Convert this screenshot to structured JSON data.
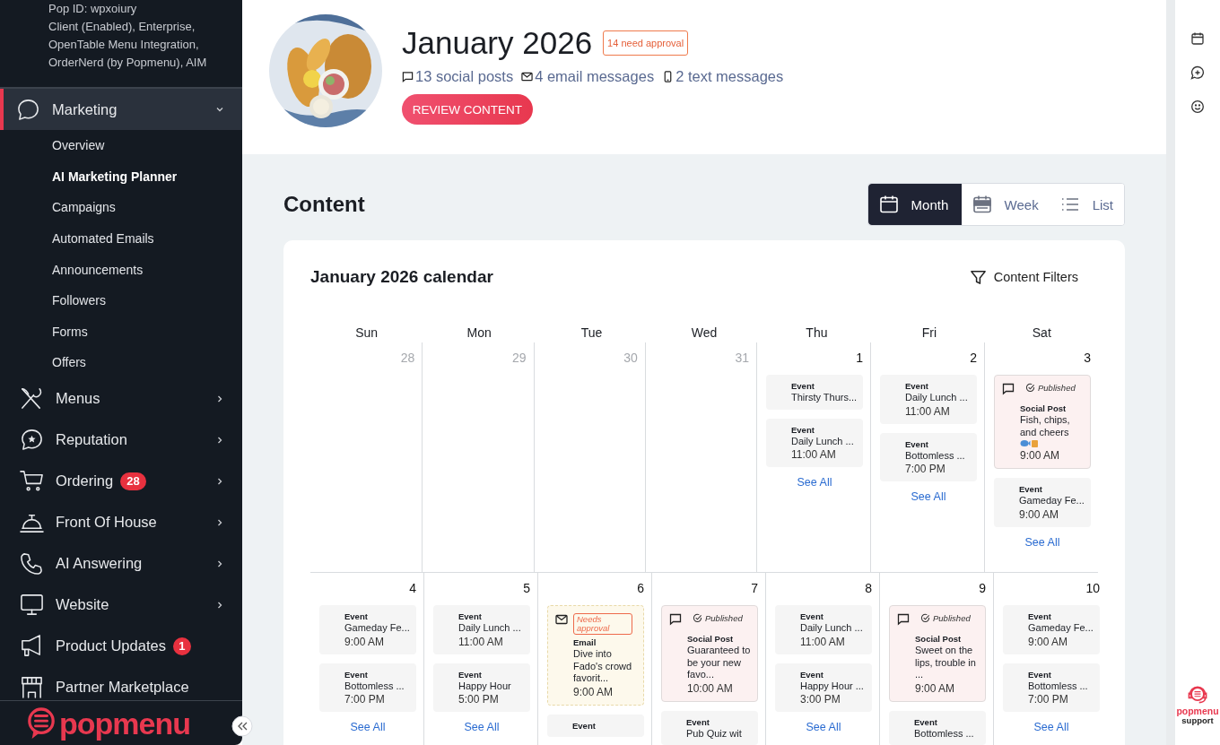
{
  "sidebar": {
    "account_lines": [
      "Pop ID: wpxoiury",
      "Client (Enabled), Enterprise,",
      "OpenTable Menu Integration,",
      "OrderNerd (by Popmenu), AIM"
    ],
    "nav": [
      {
        "label": "Marketing",
        "selected": true,
        "expanded": true,
        "children": [
          {
            "label": "Overview",
            "selected": false
          },
          {
            "label": "AI Marketing Planner",
            "selected": true
          },
          {
            "label": "Campaigns",
            "selected": false
          },
          {
            "label": "Automated Emails",
            "selected": false
          },
          {
            "label": "Announcements",
            "selected": false
          },
          {
            "label": "Followers",
            "selected": false
          },
          {
            "label": "Forms",
            "selected": false
          },
          {
            "label": "Offers",
            "selected": false
          }
        ]
      },
      {
        "label": "Menus",
        "selected": false,
        "expanded": false
      },
      {
        "label": "Reputation",
        "selected": false,
        "expanded": false
      },
      {
        "label": "Ordering",
        "selected": false,
        "expanded": false,
        "badge": "28"
      },
      {
        "label": "Front Of House",
        "selected": false,
        "expanded": false
      },
      {
        "label": "AI Answering",
        "selected": false,
        "expanded": false
      },
      {
        "label": "Website",
        "selected": false,
        "expanded": false
      },
      {
        "label": "Product Updates",
        "selected": false,
        "badge": "1"
      },
      {
        "label": "Partner Marketplace",
        "selected": false
      }
    ],
    "logo": "popmenu"
  },
  "header": {
    "title": "January 2026",
    "approval_badge": "14 need approval",
    "stats": [
      "13 social posts",
      "4 email messages",
      "2 text messages"
    ],
    "review_button": "REVIEW CONTENT"
  },
  "content": {
    "heading": "Content",
    "views": [
      {
        "label": "Month",
        "selected": true
      },
      {
        "label": "Week",
        "selected": false
      },
      {
        "label": "List",
        "selected": false
      }
    ]
  },
  "calendar": {
    "title": "January 2026 calendar",
    "filters_button": "Content Filters",
    "weekdays": [
      "Sun",
      "Mon",
      "Tue",
      "Wed",
      "Thu",
      "Fri",
      "Sat"
    ],
    "weeks": [
      {
        "days": [
          {
            "date": "28",
            "muted": true
          },
          {
            "date": "29",
            "muted": true
          },
          {
            "date": "30",
            "muted": true
          },
          {
            "date": "31",
            "muted": true
          },
          {
            "date": "1",
            "muted": false,
            "items": [
              {
                "kind": "event",
                "label": "Event",
                "title": "Thirsty Thurs..."
              },
              {
                "kind": "event",
                "label": "Event",
                "title": "Daily Lunch ...",
                "time": "11:00 AM"
              }
            ],
            "see_all": "See All"
          },
          {
            "date": "2",
            "muted": false,
            "items": [
              {
                "kind": "event",
                "label": "Event",
                "title": "Daily Lunch ...",
                "time": "11:00 AM"
              },
              {
                "kind": "event",
                "label": "Event",
                "title": "Bottomless ...",
                "time": "7:00 PM"
              }
            ],
            "see_all": "See All"
          },
          {
            "date": "3",
            "muted": false,
            "items": [
              {
                "kind": "social",
                "status": "Published",
                "label": "Social Post",
                "title": "Fish, chips, and cheers",
                "emoji": true,
                "time": "9:00 AM"
              },
              {
                "kind": "event",
                "label": "Event",
                "title": "Gameday Fe...",
                "time": "9:00 AM"
              }
            ],
            "see_all": "See All"
          }
        ]
      },
      {
        "days": [
          {
            "date": "4",
            "muted": false,
            "items": [
              {
                "kind": "event",
                "label": "Event",
                "title": "Gameday Fe...",
                "time": "9:00 AM"
              },
              {
                "kind": "event",
                "label": "Event",
                "title": "Bottomless ...",
                "time": "7:00 PM"
              }
            ],
            "see_all": "See All"
          },
          {
            "date": "5",
            "muted": false,
            "items": [
              {
                "kind": "event",
                "label": "Event",
                "title": "Daily Lunch ...",
                "time": "11:00 AM"
              },
              {
                "kind": "event",
                "label": "Event",
                "title": "Happy Hour",
                "time": "5:00 PM"
              }
            ],
            "see_all": "See All"
          },
          {
            "date": "6",
            "muted": false,
            "items": [
              {
                "kind": "email",
                "status": "Needs approval",
                "label": "Email",
                "title": "Dive into Fado's crowd favorit...",
                "time": "9:00 AM"
              },
              {
                "kind": "event",
                "label": "Event"
              }
            ]
          },
          {
            "date": "7",
            "muted": false,
            "items": [
              {
                "kind": "social",
                "status": "Published",
                "label": "Social Post",
                "title": "Guaranteed to be your new favo...",
                "time": "10:00 AM"
              },
              {
                "kind": "event",
                "label": "Event",
                "title": "Pub Quiz wit"
              }
            ]
          },
          {
            "date": "8",
            "muted": false,
            "items": [
              {
                "kind": "event",
                "label": "Event",
                "title": "Daily Lunch ...",
                "time": "11:00 AM"
              },
              {
                "kind": "event",
                "label": "Event",
                "title": "Happy Hour ...",
                "time": "3:00 PM"
              }
            ],
            "see_all": "See All"
          },
          {
            "date": "9",
            "muted": false,
            "items": [
              {
                "kind": "social",
                "status": "Published",
                "label": "Social Post",
                "title": "Sweet on the lips, trouble in ...",
                "time": "9:00 AM"
              },
              {
                "kind": "event",
                "label": "Event",
                "title": "Bottomless ..."
              }
            ]
          },
          {
            "date": "10",
            "muted": false,
            "items": [
              {
                "kind": "event",
                "label": "Event",
                "title": "Gameday Fe...",
                "time": "9:00 AM"
              },
              {
                "kind": "event",
                "label": "Event",
                "title": "Bottomless ...",
                "time": "7:00 PM"
              }
            ],
            "see_all": "See All"
          }
        ]
      }
    ]
  },
  "support": {
    "brand": "popmenu",
    "label": "support"
  }
}
